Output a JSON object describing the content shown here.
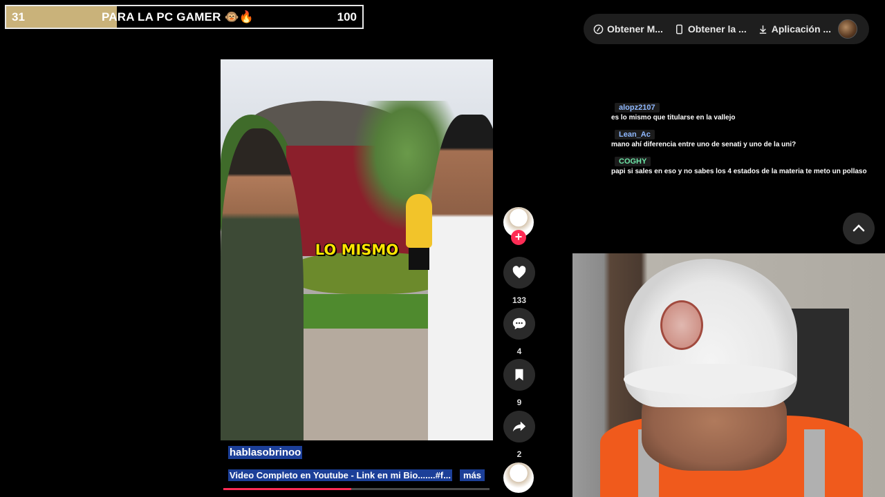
{
  "goal": {
    "current": "31",
    "title": "PARA LA PC GAMER 🐵🔥",
    "target": "100",
    "progress_fraction": 0.31
  },
  "top_actions": [
    {
      "label": "Obtener M...",
      "icon": "pc-icon"
    },
    {
      "label": "Obtener la ...",
      "icon": "phone-icon"
    },
    {
      "label": "Aplicación ...",
      "icon": "download-icon"
    }
  ],
  "video": {
    "caption": "LO MISMO",
    "username": "hablasobrinoo",
    "description": "Video Completo en Youtube - Link en mi Bio.......#f...",
    "more_label": "más",
    "playback_progress": 0.48
  },
  "actions": {
    "follow_label": "+",
    "likes": "133",
    "comments": "4",
    "saves": "9",
    "shares": "2"
  },
  "chat": [
    {
      "user": "alopz2107",
      "user_color": "#8fb8ff",
      "text": "es lo mismo que titularse en la vallejo"
    },
    {
      "user": "Lean_Ac",
      "user_color": "#8fb8ff",
      "text": "mano ahí diferencia entre uno de senati y uno de la uni?"
    },
    {
      "user": "COGHY",
      "user_color": "#6ee7a8",
      "text": "papi si sales en eso y no sabes los 4 estados de la materia te meto un pollaso"
    }
  ],
  "colors": {
    "accent": "#fe2c55",
    "goal_fill": "#c9b27a",
    "highlight": "#1c3f98"
  }
}
